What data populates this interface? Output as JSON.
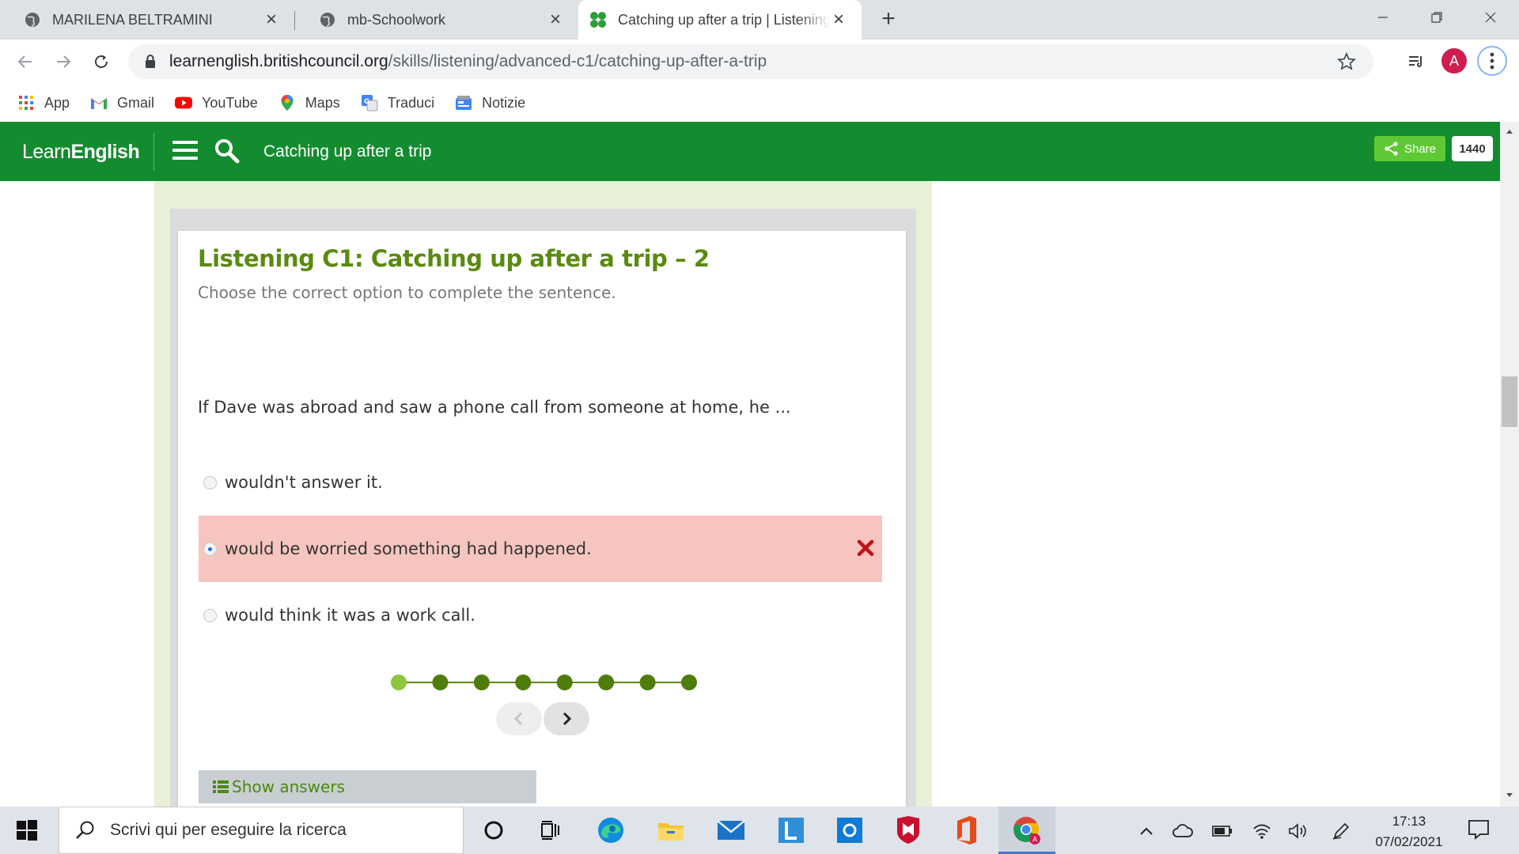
{
  "browser": {
    "tabs": [
      {
        "label": "MARILENA BELTRAMINI",
        "active": false
      },
      {
        "label": "mb-Schoolwork",
        "active": false
      },
      {
        "label": "Catching up after a trip | Listening",
        "active": true
      }
    ],
    "url_host": "learnenglish.britishcouncil.org",
    "url_path": "/skills/listening/advanced-c1/catching-up-after-a-trip",
    "profile_initial": "A",
    "bookmarks": [
      {
        "label": "App",
        "icon": "apps-grid-icon"
      },
      {
        "label": "Gmail",
        "icon": "gmail-icon"
      },
      {
        "label": "YouTube",
        "icon": "youtube-icon"
      },
      {
        "label": "Maps",
        "icon": "maps-pin-icon"
      },
      {
        "label": "Traduci",
        "icon": "translate-icon"
      },
      {
        "label": "Notizie",
        "icon": "news-icon"
      }
    ]
  },
  "site": {
    "logo_light": "Learn",
    "logo_bold": "English",
    "page_title": "Catching up after a trip",
    "share_label": "Share",
    "share_count": "1440",
    "brand_color": "#138c2f"
  },
  "exercise": {
    "title": "Listening C1: Catching up after a trip – 2",
    "instruction": "Choose the correct option to complete the sentence.",
    "question": "If Dave was abroad and saw a phone call from someone at home, he ...",
    "options": [
      {
        "label": "wouldn't answer it.",
        "selected": false,
        "state": "none"
      },
      {
        "label": "would be worried something had happened.",
        "selected": true,
        "state": "wrong"
      },
      {
        "label": "would think it was a work call.",
        "selected": false,
        "state": "none"
      }
    ],
    "progress": {
      "total": 8,
      "current": 1
    },
    "show_answers_label": "Show answers"
  },
  "taskbar": {
    "search_placeholder": "Scrivi qui per eseguire la ricerca",
    "time": "17:13",
    "date": "07/02/2021"
  }
}
